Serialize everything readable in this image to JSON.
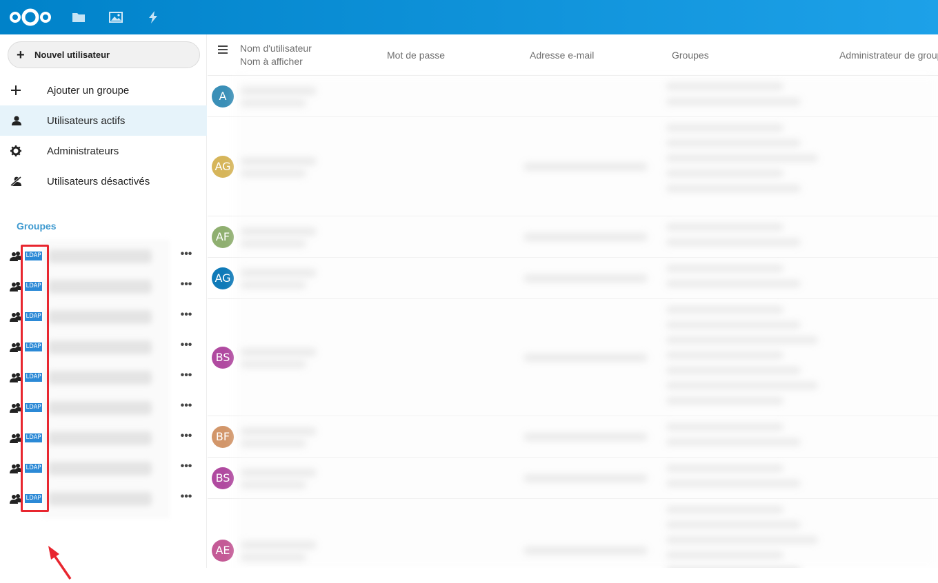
{
  "header": {
    "apps": [
      {
        "name": "files-icon"
      },
      {
        "name": "photos-icon"
      },
      {
        "name": "activity-icon"
      }
    ],
    "brand_color": "#0082c9"
  },
  "sidebar": {
    "new_user_label": "Nouvel utilisateur",
    "items": [
      {
        "label": "Ajouter un groupe",
        "icon": "plus-icon"
      },
      {
        "label": "Utilisateurs actifs",
        "icon": "user-icon",
        "active": true
      },
      {
        "label": "Administrateurs",
        "icon": "gear-icon"
      },
      {
        "label": "Utilisateurs désactivés",
        "icon": "disabled-user-icon"
      }
    ],
    "groups_caption": "Groupes",
    "groups": [
      {
        "badge": "LDAP"
      },
      {
        "badge": "LDAP"
      },
      {
        "badge": "LDAP"
      },
      {
        "badge": "LDAP"
      },
      {
        "badge": "LDAP"
      },
      {
        "badge": "LDAP"
      },
      {
        "badge": "LDAP"
      },
      {
        "badge": "LDAP"
      },
      {
        "badge": "LDAP"
      }
    ],
    "more_label": "•••"
  },
  "table": {
    "columns": {
      "username": "Nom d'utilisateur",
      "displayname": "Nom à afficher",
      "password": "Mot de passe",
      "email": "Adresse e-mail",
      "groups": "Groupes",
      "admin": "Administrateur de groupe"
    },
    "rows": [
      {
        "initials": "A",
        "color": "#3a8fb7"
      },
      {
        "initials": "AG",
        "color": "#d6b55a"
      },
      {
        "initials": "AF",
        "color": "#8faf70"
      },
      {
        "initials": "AG",
        "color": "#0f7ab8"
      },
      {
        "initials": "BS",
        "color": "#b04aa0"
      },
      {
        "initials": "BF",
        "color": "#d2966a"
      },
      {
        "initials": "BS",
        "color": "#b04aa0"
      },
      {
        "initials": "AE",
        "color": "#c45a96"
      }
    ]
  },
  "annotation_color": "#e8262f"
}
